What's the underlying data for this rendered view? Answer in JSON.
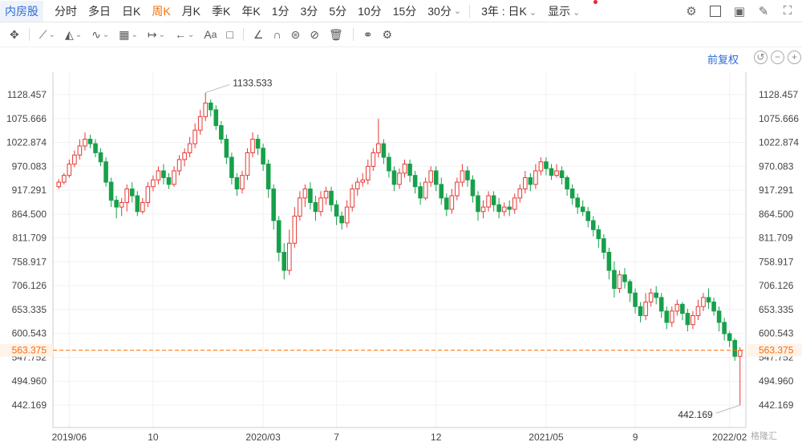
{
  "toolbar": {
    "stock_name": "内房股",
    "periods": [
      "分时",
      "多日",
      "日K",
      "周K",
      "月K",
      "季K",
      "年K",
      "1分",
      "3分",
      "5分",
      "10分",
      "15分",
      "30分"
    ],
    "active_period": "周K",
    "range_select": "3年 : 日K",
    "display_label": "显示"
  },
  "adjust_label": "前复权",
  "colors": {
    "up": "#e53935",
    "down": "#16a04a",
    "current": "#ff6a00",
    "accent": "#2d6bd6"
  },
  "watermark": "格隆汇",
  "chart_data": {
    "type": "candlestick",
    "y_ticks": [
      "1128.457",
      "1075.666",
      "1022.874",
      "970.083",
      "917.291",
      "864.500",
      "811.709",
      "758.917",
      "706.126",
      "653.335",
      "600.543",
      "547.752",
      "494.960",
      "442.169"
    ],
    "ylim": [
      442.169,
      1128.457
    ],
    "x_ticks": [
      "2019/06",
      "10",
      "2020/03",
      "7",
      "12",
      "2021/05",
      "9",
      "2022/02"
    ],
    "high_annotation": "1133.533",
    "low_annotation": "442.169",
    "current_price": "563.375",
    "candles": [
      [
        925,
        935,
        920,
        942
      ],
      [
        935,
        950,
        930,
        955
      ],
      [
        950,
        975,
        945,
        985
      ],
      [
        975,
        995,
        968,
        1005
      ],
      [
        995,
        1015,
        985,
        1030
      ],
      [
        1015,
        1030,
        1005,
        1045
      ],
      [
        1030,
        1020,
        1010,
        1040
      ],
      [
        1020,
        1000,
        990,
        1030
      ],
      [
        1000,
        980,
        970,
        1010
      ],
      [
        980,
        935,
        925,
        990
      ],
      [
        935,
        895,
        880,
        945
      ],
      [
        895,
        880,
        855,
        905
      ],
      [
        880,
        890,
        860,
        900
      ],
      [
        890,
        920,
        870,
        930
      ],
      [
        920,
        905,
        890,
        935
      ],
      [
        905,
        870,
        860,
        915
      ],
      [
        870,
        890,
        865,
        900
      ],
      [
        890,
        925,
        880,
        935
      ],
      [
        925,
        940,
        915,
        950
      ],
      [
        940,
        960,
        930,
        970
      ],
      [
        960,
        945,
        930,
        975
      ],
      [
        945,
        930,
        920,
        955
      ],
      [
        930,
        960,
        925,
        970
      ],
      [
        960,
        985,
        950,
        995
      ],
      [
        985,
        1000,
        970,
        1010
      ],
      [
        1000,
        1020,
        990,
        1035
      ],
      [
        1020,
        1050,
        1010,
        1065
      ],
      [
        1050,
        1080,
        1040,
        1095
      ],
      [
        1080,
        1110,
        1070,
        1133
      ],
      [
        1110,
        1095,
        1080,
        1118
      ],
      [
        1095,
        1060,
        1050,
        1105
      ],
      [
        1060,
        1030,
        1020,
        1070
      ],
      [
        1030,
        990,
        975,
        1040
      ],
      [
        990,
        945,
        930,
        1000
      ],
      [
        945,
        920,
        905,
        955
      ],
      [
        920,
        950,
        910,
        960
      ],
      [
        950,
        1000,
        940,
        1010
      ],
      [
        1000,
        1030,
        990,
        1045
      ],
      [
        1030,
        1010,
        995,
        1040
      ],
      [
        1010,
        975,
        960,
        1020
      ],
      [
        975,
        920,
        900,
        985
      ],
      [
        920,
        850,
        830,
        930
      ],
      [
        850,
        780,
        760,
        860
      ],
      [
        780,
        740,
        720,
        800
      ],
      [
        740,
        800,
        730,
        830
      ],
      [
        800,
        860,
        790,
        880
      ],
      [
        860,
        900,
        850,
        915
      ],
      [
        900,
        920,
        880,
        930
      ],
      [
        920,
        890,
        875,
        935
      ],
      [
        890,
        870,
        850,
        905
      ],
      [
        870,
        900,
        860,
        915
      ],
      [
        900,
        915,
        885,
        925
      ],
      [
        915,
        885,
        870,
        925
      ],
      [
        885,
        860,
        840,
        895
      ],
      [
        860,
        845,
        830,
        870
      ],
      [
        845,
        880,
        835,
        895
      ],
      [
        880,
        920,
        870,
        930
      ],
      [
        920,
        935,
        905,
        945
      ],
      [
        935,
        940,
        925,
        955
      ],
      [
        940,
        970,
        930,
        985
      ],
      [
        970,
        1000,
        960,
        1010
      ],
      [
        1000,
        1020,
        990,
        1075
      ],
      [
        1020,
        990,
        975,
        1030
      ],
      [
        990,
        960,
        945,
        1000
      ],
      [
        960,
        930,
        915,
        970
      ],
      [
        930,
        955,
        920,
        965
      ],
      [
        955,
        975,
        945,
        985
      ],
      [
        975,
        950,
        935,
        985
      ],
      [
        950,
        925,
        910,
        960
      ],
      [
        925,
        900,
        885,
        935
      ],
      [
        900,
        935,
        895,
        945
      ],
      [
        935,
        960,
        925,
        970
      ],
      [
        960,
        930,
        915,
        970
      ],
      [
        930,
        900,
        885,
        945
      ],
      [
        900,
        875,
        860,
        910
      ],
      [
        875,
        905,
        865,
        920
      ],
      [
        905,
        935,
        895,
        945
      ],
      [
        935,
        960,
        925,
        975
      ],
      [
        960,
        940,
        925,
        970
      ],
      [
        940,
        905,
        890,
        950
      ],
      [
        905,
        870,
        850,
        915
      ],
      [
        870,
        880,
        855,
        895
      ],
      [
        880,
        905,
        870,
        915
      ],
      [
        905,
        885,
        870,
        915
      ],
      [
        885,
        870,
        855,
        900
      ],
      [
        870,
        880,
        860,
        890
      ],
      [
        880,
        875,
        860,
        895
      ],
      [
        875,
        900,
        865,
        910
      ],
      [
        900,
        920,
        890,
        930
      ],
      [
        920,
        945,
        910,
        960
      ],
      [
        945,
        930,
        915,
        955
      ],
      [
        930,
        960,
        920,
        975
      ],
      [
        960,
        980,
        950,
        990
      ],
      [
        980,
        965,
        950,
        990
      ],
      [
        965,
        950,
        940,
        975
      ],
      [
        950,
        960,
        945,
        975
      ],
      [
        960,
        945,
        930,
        970
      ],
      [
        945,
        920,
        905,
        950
      ],
      [
        920,
        900,
        885,
        930
      ],
      [
        900,
        880,
        865,
        910
      ],
      [
        880,
        870,
        860,
        895
      ],
      [
        870,
        850,
        835,
        880
      ],
      [
        850,
        830,
        815,
        860
      ],
      [
        830,
        810,
        790,
        840
      ],
      [
        810,
        780,
        765,
        820
      ],
      [
        780,
        740,
        720,
        790
      ],
      [
        740,
        700,
        680,
        760
      ],
      [
        700,
        730,
        690,
        740
      ],
      [
        730,
        715,
        700,
        745
      ],
      [
        715,
        690,
        670,
        720
      ],
      [
        690,
        660,
        645,
        700
      ],
      [
        660,
        640,
        625,
        670
      ],
      [
        640,
        670,
        630,
        690
      ],
      [
        670,
        690,
        660,
        700
      ],
      [
        690,
        680,
        665,
        705
      ],
      [
        680,
        650,
        635,
        690
      ],
      [
        650,
        625,
        610,
        660
      ],
      [
        625,
        650,
        615,
        660
      ],
      [
        650,
        665,
        640,
        675
      ],
      [
        665,
        645,
        630,
        670
      ],
      [
        645,
        620,
        605,
        655
      ],
      [
        620,
        640,
        610,
        650
      ],
      [
        640,
        660,
        630,
        675
      ],
      [
        660,
        680,
        650,
        690
      ],
      [
        680,
        670,
        655,
        700
      ],
      [
        670,
        650,
        640,
        680
      ],
      [
        650,
        625,
        605,
        660
      ],
      [
        625,
        600,
        585,
        635
      ],
      [
        600,
        585,
        570,
        605
      ],
      [
        585,
        550,
        540,
        590
      ],
      [
        550,
        563,
        442,
        570
      ]
    ]
  }
}
